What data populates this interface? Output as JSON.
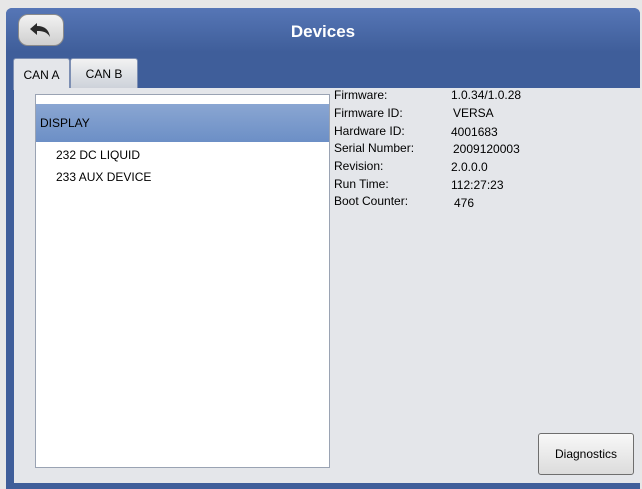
{
  "header": {
    "title": "Devices",
    "back_icon": "back-arrow-icon"
  },
  "tabs": [
    {
      "label": "CAN A",
      "active": true
    },
    {
      "label": "CAN B",
      "active": false
    }
  ],
  "device_list": {
    "items": [
      {
        "label": "DISPLAY",
        "selected": true
      },
      {
        "label": "232 DC LIQUID",
        "selected": false
      },
      {
        "label": "233 AUX DEVICE",
        "selected": false
      }
    ]
  },
  "device_info": {
    "rows": [
      {
        "label": "Firmware:",
        "value": "1.0.34/1.0.28"
      },
      {
        "label": "Firmware ID:",
        "value": "VERSA"
      },
      {
        "label": "Hardware ID:",
        "value": "4001683"
      },
      {
        "label": "Serial Number:",
        "value": "2009120003"
      },
      {
        "label": "Revision:",
        "value": "2.0.0.0"
      },
      {
        "label": "Run Time:",
        "value": "112:27:23"
      },
      {
        "label": "Boot Counter:",
        "value": "476"
      }
    ]
  },
  "actions": {
    "diagnostics_label": "Diagnostics"
  },
  "colors": {
    "frame": "#3f5e9a",
    "selection": "#7b9acb",
    "panel": "#e4e6ea"
  }
}
